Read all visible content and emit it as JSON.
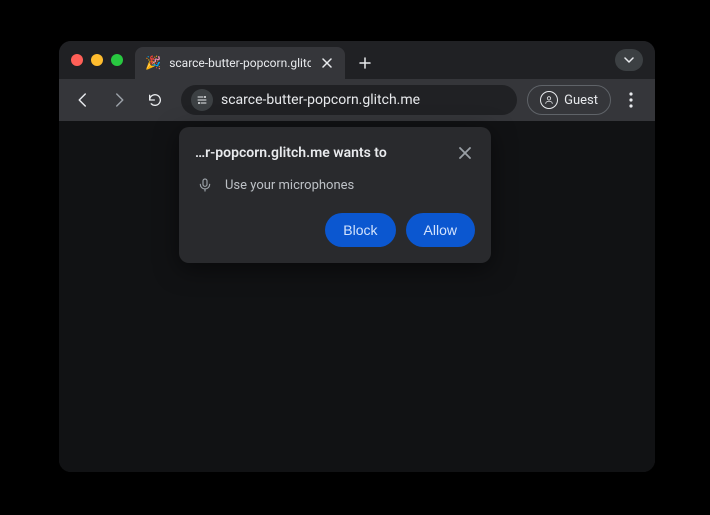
{
  "tab": {
    "favicon": "🎉",
    "title": "scarce-butter-popcorn.glitch"
  },
  "omnibox": {
    "url": "scarce-butter-popcorn.glitch.me"
  },
  "profile": {
    "label": "Guest"
  },
  "prompt": {
    "origin_text": "…r-popcorn.glitch.me wants to",
    "permission_label": "Use your microphones",
    "block_label": "Block",
    "allow_label": "Allow"
  }
}
